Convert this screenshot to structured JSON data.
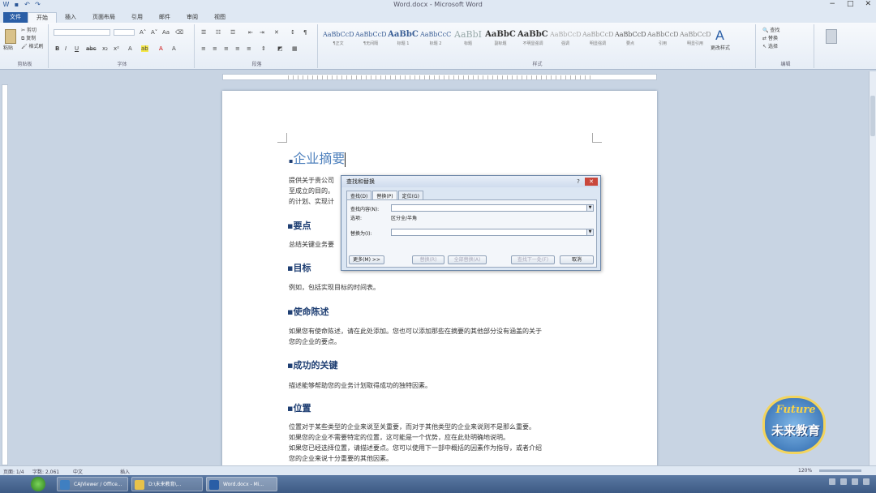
{
  "window": {
    "title": "Word.docx - Microsoft Word",
    "controls": [
      "−",
      "□",
      "✕"
    ]
  },
  "ribbon_tabs": [
    "文件",
    "开始",
    "插入",
    "页面布局",
    "引用",
    "邮件",
    "审阅",
    "视图"
  ],
  "ribbon": {
    "clipboard": {
      "paste": "粘贴",
      "cut": "剪切",
      "copy": "复制",
      "painter": "格式刷",
      "label": "剪贴板"
    },
    "font": {
      "label": "字体"
    },
    "paragraph": {
      "label": "段落"
    },
    "styles": {
      "label": "样式",
      "items": [
        {
          "sample": "AaBbCcDd",
          "name": "¶正文"
        },
        {
          "sample": "AaBbCcDd",
          "name": "¶无间隔"
        },
        {
          "sample": "AaBbC",
          "name": "标题 1"
        },
        {
          "sample": "AaBbCcC",
          "name": "标题 2"
        },
        {
          "sample": "AaBbI",
          "name": "标题"
        },
        {
          "sample": "AaBbC",
          "name": "副标题"
        },
        {
          "sample": "AaBbCcDd",
          "name": "不明显强调"
        },
        {
          "sample": "AaBbCcDd",
          "name": "强调"
        },
        {
          "sample": "AaBbCcDd",
          "name": "明显强调"
        },
        {
          "sample": "AaBbCcDd",
          "name": "要点"
        },
        {
          "sample": "AaBbCcDd",
          "name": "引用"
        },
        {
          "sample": "AaBbCcDd",
          "name": "明显引用"
        }
      ],
      "change_styles": "更改样式"
    },
    "editing": {
      "find": "查找",
      "replace": "替换",
      "select": "选择",
      "label": "编辑"
    }
  },
  "document": {
    "heading": "企业摘要",
    "intro_lines": [
      "提供关于贵公司",
      "至成立的目的。",
      "的计划、实现计"
    ],
    "sections": [
      {
        "title": "要点",
        "body": [
          "总结关键业务要"
        ]
      },
      {
        "title": "目标",
        "body": [
          "例如，包括实现目标的时间表。"
        ]
      },
      {
        "title": "使命陈述",
        "body": [
          "如果您有使命陈述，请在此处添加。您也可以添加那些在摘要的其他部分没有涵盖的关于",
          "您的企业的要点。"
        ]
      },
      {
        "title": "成功的关键",
        "body": [
          "描述能够帮助您的业务计划取得成功的独特因素。"
        ]
      },
      {
        "title": "位置",
        "body": [
          "位置对于某些类型的企业来说至关重要，而对于其他类型的企业来说则不是那么重要。",
          "如果您的企业不需要特定的位置，这可能是一个优势，应在此处明确地说明。",
          "如果您已经选择位置，请描述要点。您可以使用下一部中概括的因素作为指导，或者介绍",
          "您的企业来说十分重要的其他因素。"
        ]
      }
    ]
  },
  "dialog": {
    "title": "查找和替换",
    "help": "?",
    "close": "✕",
    "tabs": [
      "查找(D)",
      "替换(P)",
      "定位(G)"
    ],
    "find_label": "查找内容(N):",
    "options_label": "选项:",
    "options_value": "区分全/半角",
    "replace_label": "替换为(I):",
    "buttons": {
      "more": "更多(M) >>",
      "replace": "替换(R)",
      "replace_all": "全部替换(A)",
      "find_next": "查找下一处(F)",
      "cancel": "取消"
    }
  },
  "statusbar": {
    "page": "页面: 1/4",
    "words": "字数: 2,061",
    "lang": "中文",
    "insert": "插入",
    "zoom": "120%"
  },
  "taskbar": {
    "items": [
      "CAJViewer / Office...",
      "D:\\未来教育\\...",
      "Word.docx - Mi..."
    ]
  },
  "logo": {
    "en": "Future",
    "zh": "未来教育"
  },
  "colors": {
    "accent": "#2a5ea6",
    "heading1": "#4f81bd",
    "heading2": "#1f3f73",
    "close": "#c9473b"
  }
}
